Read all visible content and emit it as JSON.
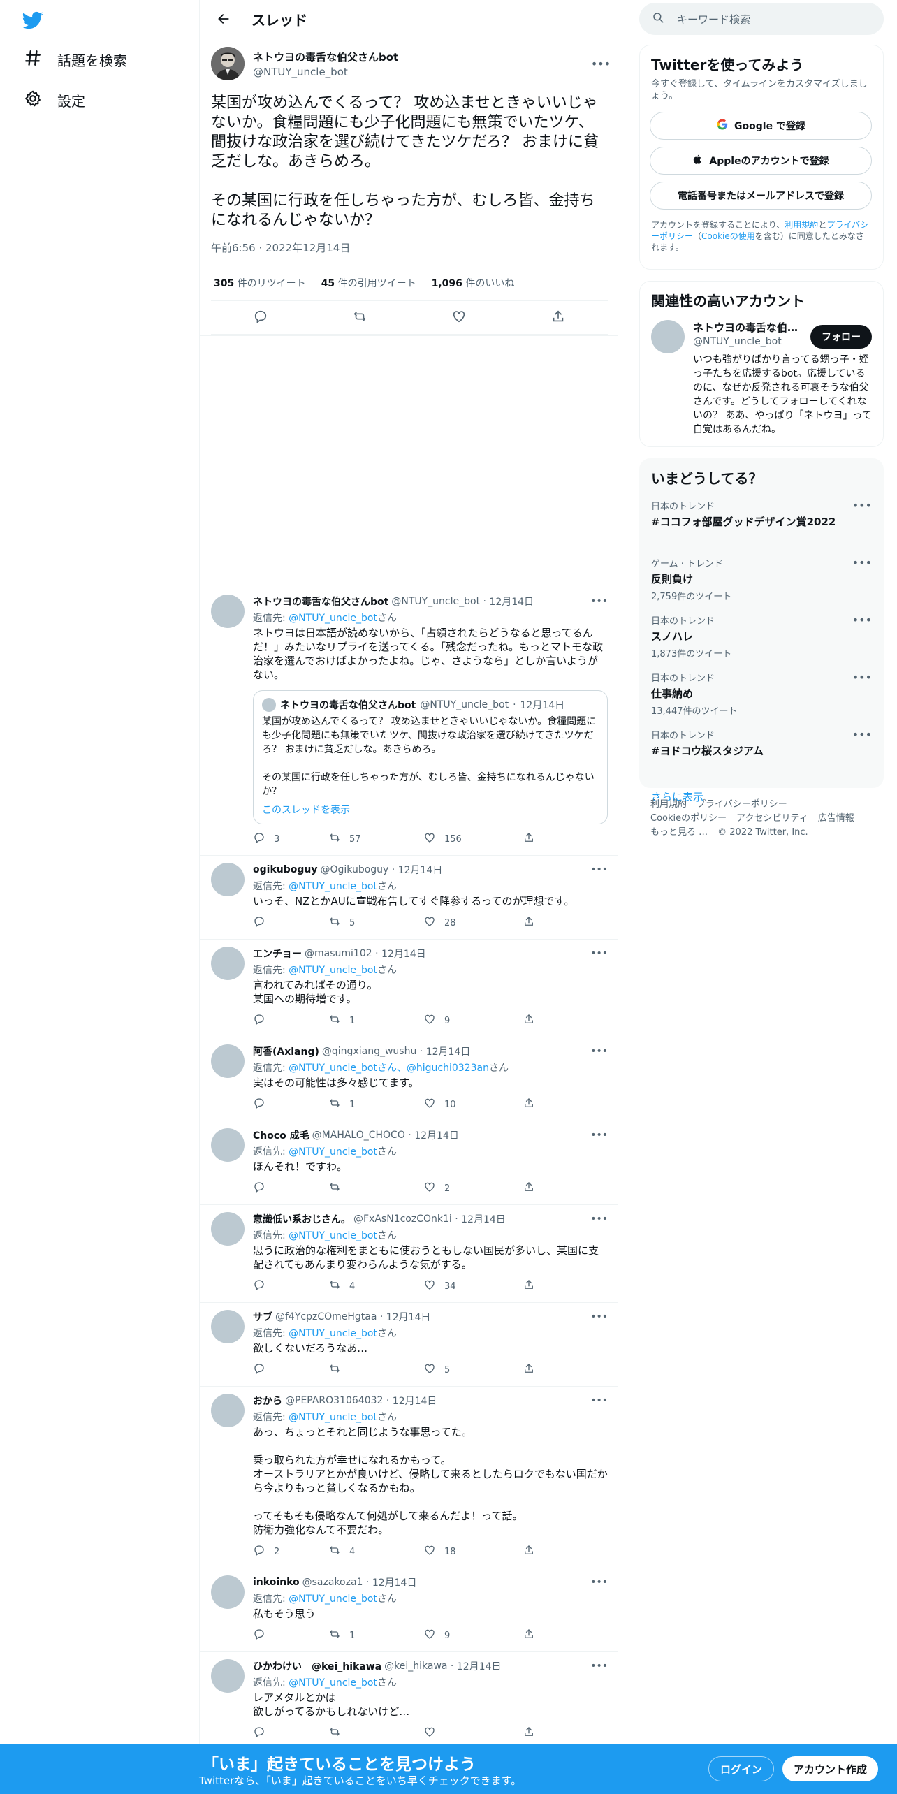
{
  "nav": {
    "explore": "話題を検索",
    "settings": "設定"
  },
  "header": {
    "title": "スレッド"
  },
  "main_tweet": {
    "name": "ネトウヨの毒舌な伯父さんbot",
    "handle": "@NTUY_uncle_bot",
    "text": "某国が攻め込んでくるって？ 攻め込ませときゃいいじゃないか。食糧問題にも少子化問題にも無策でいたツケ、間抜けな政治家を選び続けてきたツケだろ？ おまけに貧乏だしな。あきらめろ。\n\nその某国に行政を任しちゃった方が、むしろ皆、金持ちになれるんじゃないか？",
    "time": "午前6:56 · 2022年12月14日",
    "retweets": "305",
    "retweets_label": "件のリツイート",
    "quotes": "45",
    "quotes_label": "件の引用ツイート",
    "likes": "1,096",
    "likes_label": "件のいいね"
  },
  "replies": [
    {
      "name": "ネトウヨの毒舌な伯父さんbot",
      "handle": "@NTUY_uncle_bot",
      "date": "12月14日",
      "reply_prefix": "返信先: ",
      "reply_to": "@NTUY_uncle_bot",
      "reply_suffix": "さん",
      "text": "ネトウヨは日本語が読めないから、「占領されたらどうなると思ってるんだ！」みたいなリプライを送ってくる。「残念だったね。もっとマトモな政治家を選んでおけばよかったよね。じゃ、さようなら」としか言いようがない。",
      "replies": "3",
      "retweets": "57",
      "likes": "156",
      "quote": {
        "name": "ネトウヨの毒舌な伯父さんbot",
        "handle": "@NTUY_uncle_bot",
        "date": "12月14日",
        "text": "某国が攻め込んでくるって？ 攻め込ませときゃいいじゃないか。食糧問題にも少子化問題にも無策でいたツケ、間抜けな政治家を選び続けてきたツケだろ？ おまけに貧乏だしな。あきらめろ。\n\nその某国に行政を任しちゃった方が、むしろ皆、金持ちになれるんじゃないか？",
        "link": "このスレッドを表示"
      }
    },
    {
      "name": "ogikuboguy",
      "handle": "@Ogikuboguy",
      "date": "12月14日",
      "reply_prefix": "返信先: ",
      "reply_to": "@NTUY_uncle_bot",
      "reply_suffix": "さん",
      "text": "いっそ、NZとかAUに宣戦布告してすぐ降参するってのが理想です。",
      "replies": "",
      "retweets": "5",
      "likes": "28"
    },
    {
      "name": "エンチョー",
      "handle": "@masumi102",
      "date": "12月14日",
      "reply_prefix": "返信先: ",
      "reply_to": "@NTUY_uncle_bot",
      "reply_suffix": "さん",
      "text": "言われてみればその通り。\n某国への期待増です。",
      "replies": "",
      "retweets": "1",
      "likes": "9"
    },
    {
      "name": "阿香(Axiang)",
      "handle": "@qingxiang_wushu",
      "date": "12月14日",
      "reply_prefix": "返信先: ",
      "reply_to": "@NTUY_uncle_botさん、@higuchi0323an",
      "reply_suffix": "さん",
      "text": "実はその可能性は多々感じてます。",
      "replies": "",
      "retweets": "1",
      "likes": "10"
    },
    {
      "name": "Choco 成毛",
      "handle": "@MAHALO_CHOCO",
      "date": "12月14日",
      "reply_prefix": "返信先: ",
      "reply_to": "@NTUY_uncle_bot",
      "reply_suffix": "さん",
      "text": "ほんそれ！ですわ。",
      "replies": "",
      "retweets": "",
      "likes": "2"
    },
    {
      "name": "意識低い系おじさん。",
      "handle": "@FxAsN1cozCOnk1i",
      "date": "12月14日",
      "reply_prefix": "返信先: ",
      "reply_to": "@NTUY_uncle_bot",
      "reply_suffix": "さん",
      "text": "思うに政治的な権利をまともに使おうともしない国民が多いし、某国に支配されてもあんまり変わらんような気がする。",
      "replies": "",
      "retweets": "4",
      "likes": "34"
    },
    {
      "name": "サブ",
      "handle": "@f4YcpzCOmeHgtaa",
      "date": "12月14日",
      "reply_prefix": "返信先: ",
      "reply_to": "@NTUY_uncle_bot",
      "reply_suffix": "さん",
      "text": "欲しくないだろうなあ…",
      "replies": "",
      "retweets": "",
      "likes": "5"
    },
    {
      "name": "おから",
      "handle": "@PEPARO31064032",
      "date": "12月14日",
      "reply_prefix": "返信先: ",
      "reply_to": "@NTUY_uncle_bot",
      "reply_suffix": "さん",
      "text": "あっ、ちょっとそれと同じような事思ってた。\n\n乗っ取られた方が幸せになれるかもって。\nオーストラリアとかが良いけど、侵略して来るとしたらロクでもない国だから今よりもっと貧しくなるかもね。\n\nってそもそも侵略なんて何処がして来るんだよ！って話。\n防衛力強化なんて不要だわ。",
      "replies": "2",
      "retweets": "4",
      "likes": "18"
    },
    {
      "name": "inkoinko",
      "handle": "@sazakoza1",
      "date": "12月14日",
      "reply_prefix": "返信先: ",
      "reply_to": "@NTUY_uncle_bot",
      "reply_suffix": "さん",
      "text": "私もそう思う",
      "replies": "",
      "retweets": "1",
      "likes": "9"
    },
    {
      "name": "ひかわけい　@kei_hikawa",
      "handle": "@kei_hikawa",
      "date": "12月14日",
      "reply_prefix": "返信先: ",
      "reply_to": "@NTUY_uncle_bot",
      "reply_suffix": "さん",
      "text": "レアメタルとかは\n欲しがってるかもしれないけど…",
      "replies": "",
      "retweets": "",
      "likes": ""
    }
  ],
  "search": {
    "placeholder": "キーワード検索"
  },
  "signup_card": {
    "title": "Twitterを使ってみよう",
    "subtitle": "今すぐ登録して、タイムラインをカスタマイズしましょう。",
    "google": "Google で登録",
    "apple": "Appleのアカウントで登録",
    "phone": "電話番号またはメールアドレスで登録",
    "legal_1": "アカウントを登録することにより、",
    "legal_terms": "利用規約",
    "legal_2": "と",
    "legal_privacy": "プライバシーポリシー",
    "legal_3": "（",
    "legal_cookie": "Cookieの使用",
    "legal_4": "を含む）に同意したとみなされます。"
  },
  "relevant": {
    "title": "関連性の高いアカウント",
    "name": "ネトウヨの毒舌な伯父さんbot",
    "handle": "@NTUY_uncle_bot",
    "follow": "フォロー",
    "bio": "いつも強がりばかり言ってる甥っ子・姪っ子たちを応援するbot。応援しているのに、なぜか反発される可哀そうな伯父さんです。どうしてフォローしてくれないの？ ああ、やっぱり「ネトウヨ」って自覚はあるんだね。"
  },
  "trends": {
    "title": "いまどうしてる？",
    "items": [
      {
        "category": "日本のトレンド",
        "name": "#ココフォ部屋グッドデザイン賞2022",
        "count": ""
      },
      {
        "category": "ゲーム · トレンド",
        "name": "反則負け",
        "count": "2,759件のツイート"
      },
      {
        "category": "日本のトレンド",
        "name": "スノハレ",
        "count": "1,873件のツイート"
      },
      {
        "category": "日本のトレンド",
        "name": "仕事納め",
        "count": "13,447件のツイート"
      },
      {
        "category": "日本のトレンド",
        "name": "#ヨドコウ桜スタジアム",
        "count": ""
      }
    ],
    "show_more": "さらに表示"
  },
  "footer": {
    "terms": "利用規約",
    "privacy": "プライバシーポリシー",
    "cookie": "Cookieのポリシー",
    "accessibility": "アクセシビリティ",
    "ads": "広告情報",
    "more": "もっと見る …",
    "copyright": "© 2022 Twitter, Inc."
  },
  "bottom_bar": {
    "headline": "「いま」起きていることを見つけよう",
    "sub": "Twitterなら、「いま」起きていることをいち早くチェックできます。",
    "login": "ログイン",
    "signup": "アカウント作成"
  },
  "colors": {
    "accent": "#1d9bf0",
    "text": "#0f1419",
    "muted": "#536471",
    "border": "#eff3f4"
  },
  "icons": [
    "twitter-logo-icon",
    "hashtag-icon",
    "gear-icon",
    "back-arrow-icon",
    "more-icon",
    "reply-icon",
    "retweet-icon",
    "like-icon",
    "share-icon",
    "search-icon",
    "google-icon",
    "apple-icon"
  ]
}
